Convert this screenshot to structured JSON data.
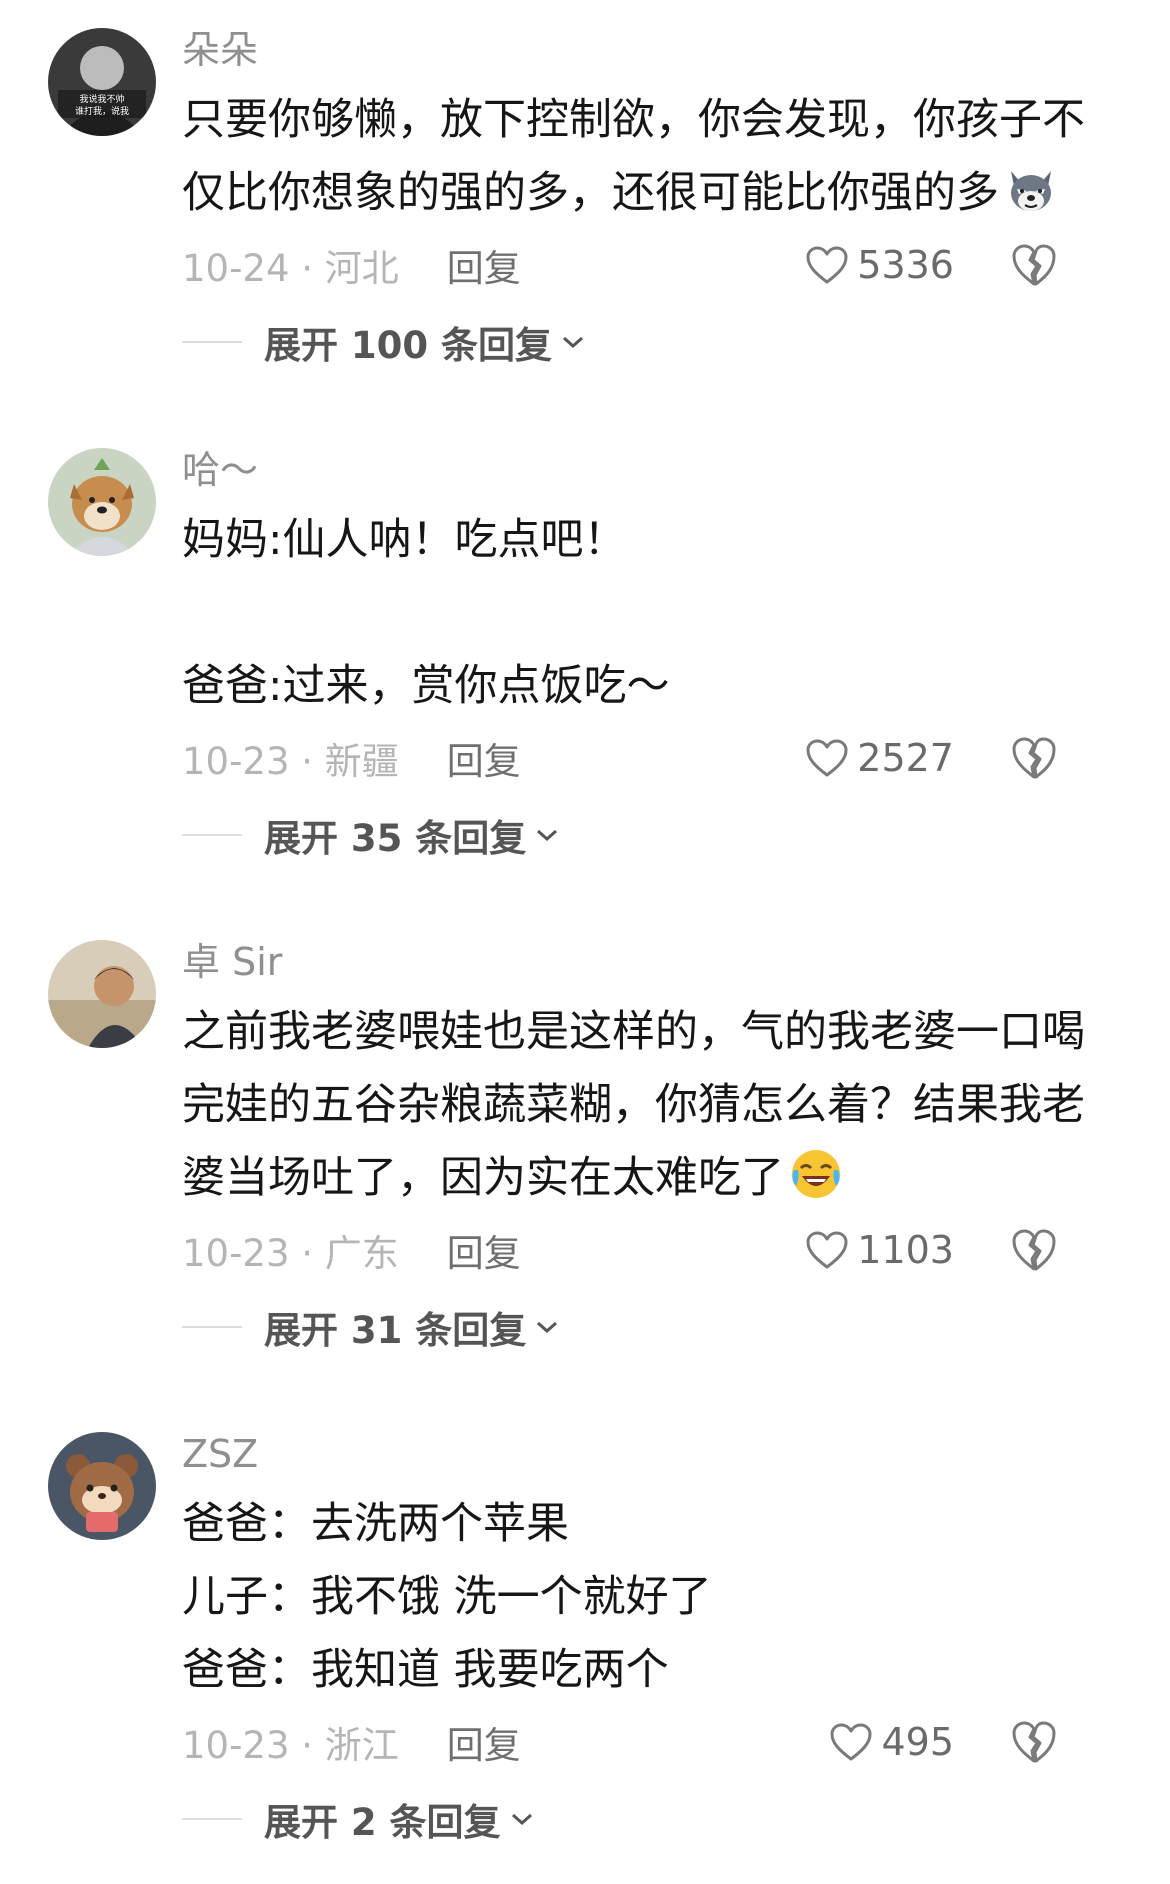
{
  "comments": [
    {
      "username": "朵朵",
      "avatar_text": "我说我不帅\n谁打我，说我",
      "lines": [
        "只要你够懒，放下控制欲，你会发现，你孩子不",
        "仅比你想象的强的多，还很可能比你强的多"
      ],
      "emoji": "wolf-face",
      "date_location": "10-24 · 河北",
      "reply_label": "回复",
      "likes": "5336",
      "expand_label": "展开 100 条回复"
    },
    {
      "username": "哈～",
      "lines": [
        "妈妈:仙人呐！吃点吧！",
        "",
        "爸爸:过来，赏你点饭吃～"
      ],
      "date_location": "10-23 · 新疆",
      "reply_label": "回复",
      "likes": "2527",
      "expand_label": "展开 35 条回复"
    },
    {
      "username": "卓 Sir",
      "lines": [
        "之前我老婆喂娃也是这样的，气的我老婆一口喝",
        "完娃的五谷杂粮蔬菜糊，你猜怎么着？结果我老",
        "婆当场吐了，因为实在太难吃了"
      ],
      "emoji": "laughing-face",
      "date_location": "10-23 · 广东",
      "reply_label": "回复",
      "likes": "1103",
      "expand_label": "展开 31 条回复"
    },
    {
      "username": "ZSZ",
      "lines": [
        "爸爸：去洗两个苹果",
        "儿子：我不饿 洗一个就好了",
        "爸爸：我知道 我要吃两个"
      ],
      "date_location": "10-23 · 浙江",
      "reply_label": "回复",
      "likes": "495",
      "expand_label": "展开 2 条回复"
    }
  ],
  "colors": {
    "username": "#8f8f8f",
    "body_text": "#161616",
    "meta": "#b5b5b5",
    "like_count": "#6a6a6a"
  },
  "icons": [
    "heart-outline-icon",
    "broken-heart-icon",
    "chevron-down-icon"
  ]
}
